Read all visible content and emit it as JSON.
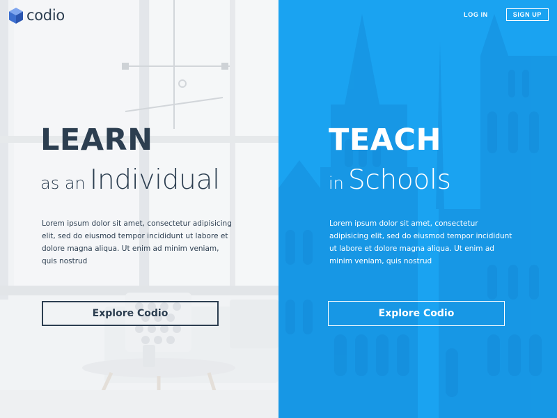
{
  "brand": {
    "name": "codio",
    "icon": "cube-icon",
    "color": "#2c3e50",
    "accent": "#3d6fcf"
  },
  "nav": {
    "login": "LOG IN",
    "signup": "SIGN UP"
  },
  "left": {
    "heading": "LEARN",
    "sub_small": "as an",
    "sub_big": "Individual",
    "paragraph": "Lorem ipsum dolor sit amet, consectetur adipisicing elit, sed do eiusmod tempor incididunt ut labore et dolore magna aliqua. Ut enim ad minim veniam, quis nostrud",
    "button": "Explore Codio",
    "text_color": "#2c3e50"
  },
  "right": {
    "heading": "TEACH",
    "sub_small": "in",
    "sub_big": "Schools",
    "paragraph": "Lorem ipsum dolor sit amet, consectetur adipisicing elit, sed do eiusmod tempor incididunt ut labore et dolore magna aliqua. Ut enim ad minim veniam, quis nostrud",
    "button": "Explore Codio",
    "panel_color": "#1aa3f0"
  }
}
